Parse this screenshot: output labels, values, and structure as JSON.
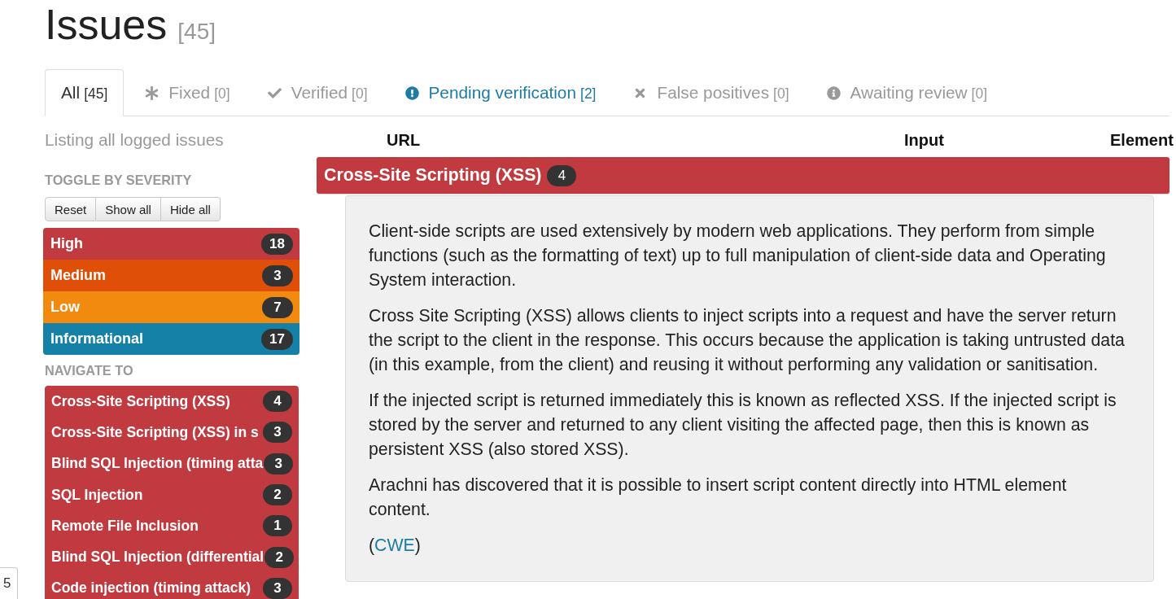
{
  "page": {
    "title": "Issues",
    "count": "[45]"
  },
  "tabs": [
    {
      "kind": "all",
      "label": "All",
      "count": "[45]",
      "selected": true,
      "color": "#333333"
    },
    {
      "kind": "fixed",
      "label": "Fixed",
      "count": "[0]",
      "selected": false,
      "color": "#999999"
    },
    {
      "kind": "verified",
      "label": "Verified",
      "count": "[0]",
      "selected": false,
      "color": "#999999"
    },
    {
      "kind": "pending",
      "label": "Pending verification",
      "count": "[2]",
      "selected": false,
      "color": "#1d7ca3"
    },
    {
      "kind": "false_positive",
      "label": "False positives",
      "count": "[0]",
      "selected": false,
      "color": "#999999"
    },
    {
      "kind": "awaiting",
      "label": "Awaiting review",
      "count": "[0]",
      "selected": false,
      "color": "#999999"
    }
  ],
  "sidebar": {
    "caption": "Listing all logged issues",
    "toggle_heading": "TOGGLE BY SEVERITY",
    "toggle_buttons": [
      "Reset",
      "Show all",
      "Hide all"
    ],
    "severities": [
      {
        "label": "High",
        "count": "18",
        "color": "#c03a40"
      },
      {
        "label": "Medium",
        "count": "3",
        "color": "#e04f08"
      },
      {
        "label": "Low",
        "count": "7",
        "color": "#f18a0f"
      },
      {
        "label": "Informational",
        "count": "17",
        "color": "#1581a7"
      }
    ],
    "navigate_heading": "NAVIGATE TO",
    "navigate_items": [
      {
        "label": "Cross-Site Scripting (XSS)",
        "count": "4"
      },
      {
        "label": "Cross-Site Scripting (XSS) in s",
        "count": "3"
      },
      {
        "label": "Blind SQL Injection (timing atta",
        "count": "3"
      },
      {
        "label": "SQL Injection",
        "count": "2"
      },
      {
        "label": "Remote File Inclusion",
        "count": "1"
      },
      {
        "label": "Blind SQL Injection (differential",
        "count": "2"
      },
      {
        "label": "Code injection (timing attack)",
        "count": "3"
      }
    ]
  },
  "table": {
    "columns": [
      "URL",
      "Input",
      "Element"
    ],
    "group": {
      "title": "Cross-Site Scripting (XSS)",
      "count": "4",
      "description": [
        "Client-side scripts are used extensively by modern web applications. They perform from simple functions (such as the formatting of text) up to full manipulation of client-side data and Operating System interaction.",
        "Cross Site Scripting (XSS) allows clients to inject scripts into a request and have the server return the script to the client in the response. This occurs because the application is taking untrusted data (in this example, from the client) and reusing it without performing any validation or sanitisation.",
        "If the injected script is returned immediately this is known as reflected XSS. If the injected script is stored by the server and returned to any client visiting the affected page, then this is known as persistent XSS (also stored XSS).",
        "Arachni has discovered that it is possible to insert script content directly into HTML element content."
      ],
      "reference": {
        "prefix": "(",
        "link": "CWE",
        "suffix": ")"
      }
    }
  },
  "floating_tab": {
    "label": "5"
  }
}
